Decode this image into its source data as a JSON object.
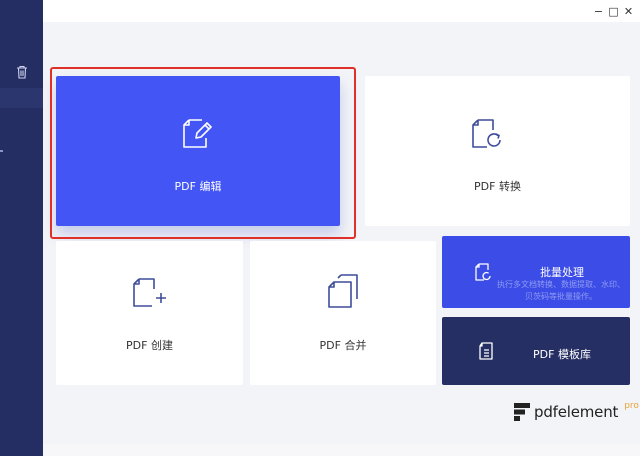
{
  "window": {
    "minimize_glyph": "−",
    "maximize_glyph": "□",
    "close_glyph": "✕"
  },
  "cards": {
    "edit": {
      "label": "PDF 编辑",
      "icon": "edit-document-icon"
    },
    "convert": {
      "label": "PDF 转换",
      "icon": "convert-document-icon"
    },
    "create": {
      "label": "PDF 创建",
      "icon": "create-document-icon"
    },
    "merge": {
      "label": "PDF 合并",
      "icon": "merge-documents-icon"
    },
    "batch": {
      "title": "批量处理",
      "description": "执行多文档转换、数据提取、水印、贝茨码等批量操作。",
      "icon": "batch-process-icon"
    },
    "template": {
      "title": "PDF 模板库",
      "icon": "template-library-icon"
    }
  },
  "brand": {
    "name": "pdfelement",
    "suffix": "pro"
  },
  "colors": {
    "sidebar": "#252e63",
    "accent": "#4356f5",
    "batch": "#3c4ce6",
    "template": "#262f63",
    "highlight": "#e0302a"
  }
}
